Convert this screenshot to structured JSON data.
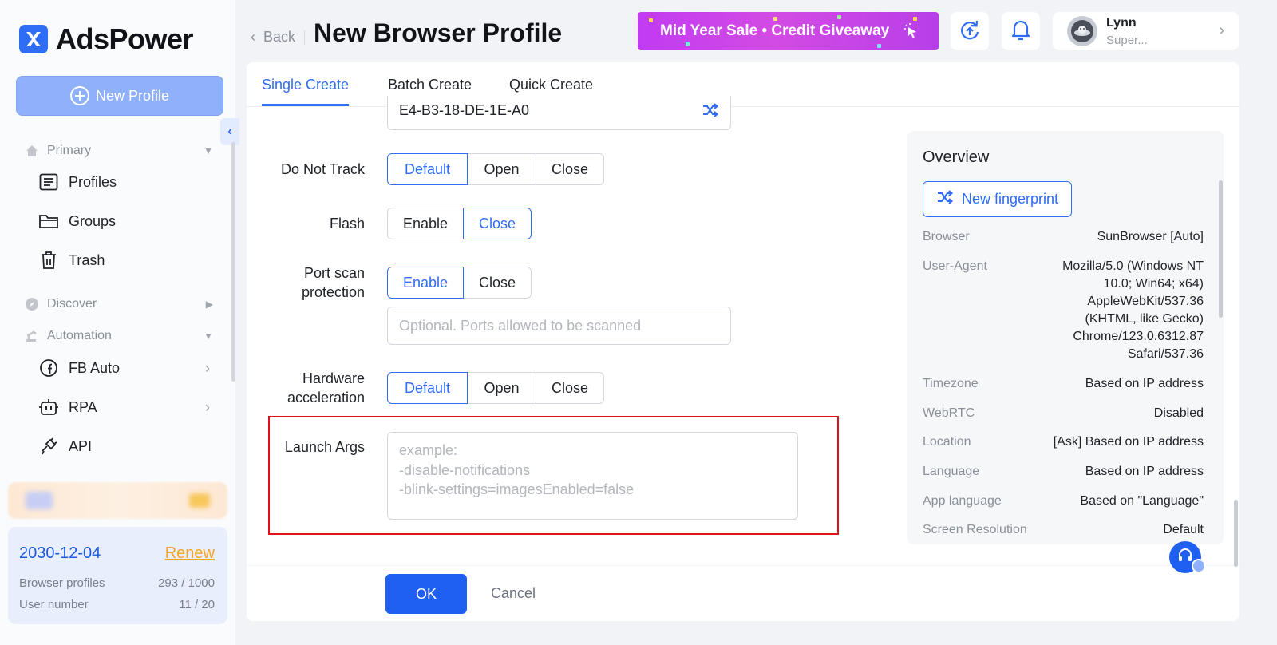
{
  "app": {
    "name": "AdsPower"
  },
  "sidebar": {
    "new_profile_label": "New Profile",
    "sections": {
      "primary": "Primary",
      "discover": "Discover",
      "automation": "Automation"
    },
    "items": {
      "profiles": "Profiles",
      "groups": "Groups",
      "trash": "Trash",
      "fb_auto": "FB Auto",
      "rpa": "RPA",
      "api": "API"
    },
    "plan": {
      "expiry": "2030-12-04",
      "renew_label": "Renew",
      "browser_profiles_label": "Browser profiles",
      "browser_profiles_value": "293 / 1000",
      "user_number_label": "User number",
      "user_number_value": "11 / 20"
    }
  },
  "header": {
    "back_label": "Back",
    "title": "New Browser Profile",
    "banner_text": "Mid Year Sale • Credit Giveaway",
    "user": {
      "name": "Lynn",
      "role": "Super..."
    }
  },
  "tabs": [
    "Single Create",
    "Batch Create",
    "Quick Create"
  ],
  "form": {
    "mac_value": "E4-B3-18-DE-1E-A0",
    "do_not_track": {
      "label": "Do Not Track",
      "options": [
        "Default",
        "Open",
        "Close"
      ],
      "selected": "Default"
    },
    "flash": {
      "label": "Flash",
      "options": [
        "Enable",
        "Close"
      ],
      "selected": "Close"
    },
    "port_scan": {
      "label_line1": "Port scan",
      "label_line2": "protection",
      "options": [
        "Enable",
        "Close"
      ],
      "selected": "Enable",
      "placeholder": "Optional. Ports allowed to be scanned"
    },
    "hardware_accel": {
      "label_line1": "Hardware",
      "label_line2": "acceleration",
      "options": [
        "Default",
        "Open",
        "Close"
      ],
      "selected": "Default"
    },
    "launch_args": {
      "label": "Launch Args",
      "placeholder_lines": [
        "example:",
        "-disable-notifications",
        "-blink-settings=imagesEnabled=false"
      ]
    },
    "ok_label": "OK",
    "cancel_label": "Cancel"
  },
  "overview": {
    "title": "Overview",
    "new_fingerprint_label": "New fingerprint",
    "rows": {
      "browser": {
        "key": "Browser",
        "value": "SunBrowser [Auto]"
      },
      "user_agent": {
        "key": "User-Agent",
        "lines": [
          "Mozilla/5.0 (Windows NT",
          "10.0; Win64; x64)",
          "AppleWebKit/537.36",
          "(KHTML, like Gecko)",
          "Chrome/123.0.6312.87",
          "Safari/537.36"
        ]
      },
      "timezone": {
        "key": "Timezone",
        "value": "Based on IP address"
      },
      "webrtc": {
        "key": "WebRTC",
        "value": "Disabled"
      },
      "location": {
        "key": "Location",
        "value": "[Ask] Based on IP address"
      },
      "language": {
        "key": "Language",
        "value": "Based on IP address"
      },
      "app_language": {
        "key": "App language",
        "value": "Based on \"Language\""
      },
      "screen_resolution": {
        "key": "Screen Resolution",
        "value": "Default"
      }
    }
  },
  "colors": {
    "accent": "#2f6df6",
    "primary_button": "#1f5ff2",
    "renew": "#f5a524",
    "highlight_box": "#e2101b"
  },
  "icons": {
    "logo": "adspower-logo-icon",
    "profiles": "list-icon",
    "groups": "folder-icon",
    "trash": "trash-icon",
    "discover": "compass-icon",
    "automation": "robot-arm-icon",
    "fb_auto": "facebook-icon",
    "rpa": "robot-icon",
    "api": "plug-icon",
    "sync": "cloud-sync-icon",
    "notifications": "bell-icon",
    "shuffle": "shuffle-icon",
    "support": "headset-icon"
  }
}
